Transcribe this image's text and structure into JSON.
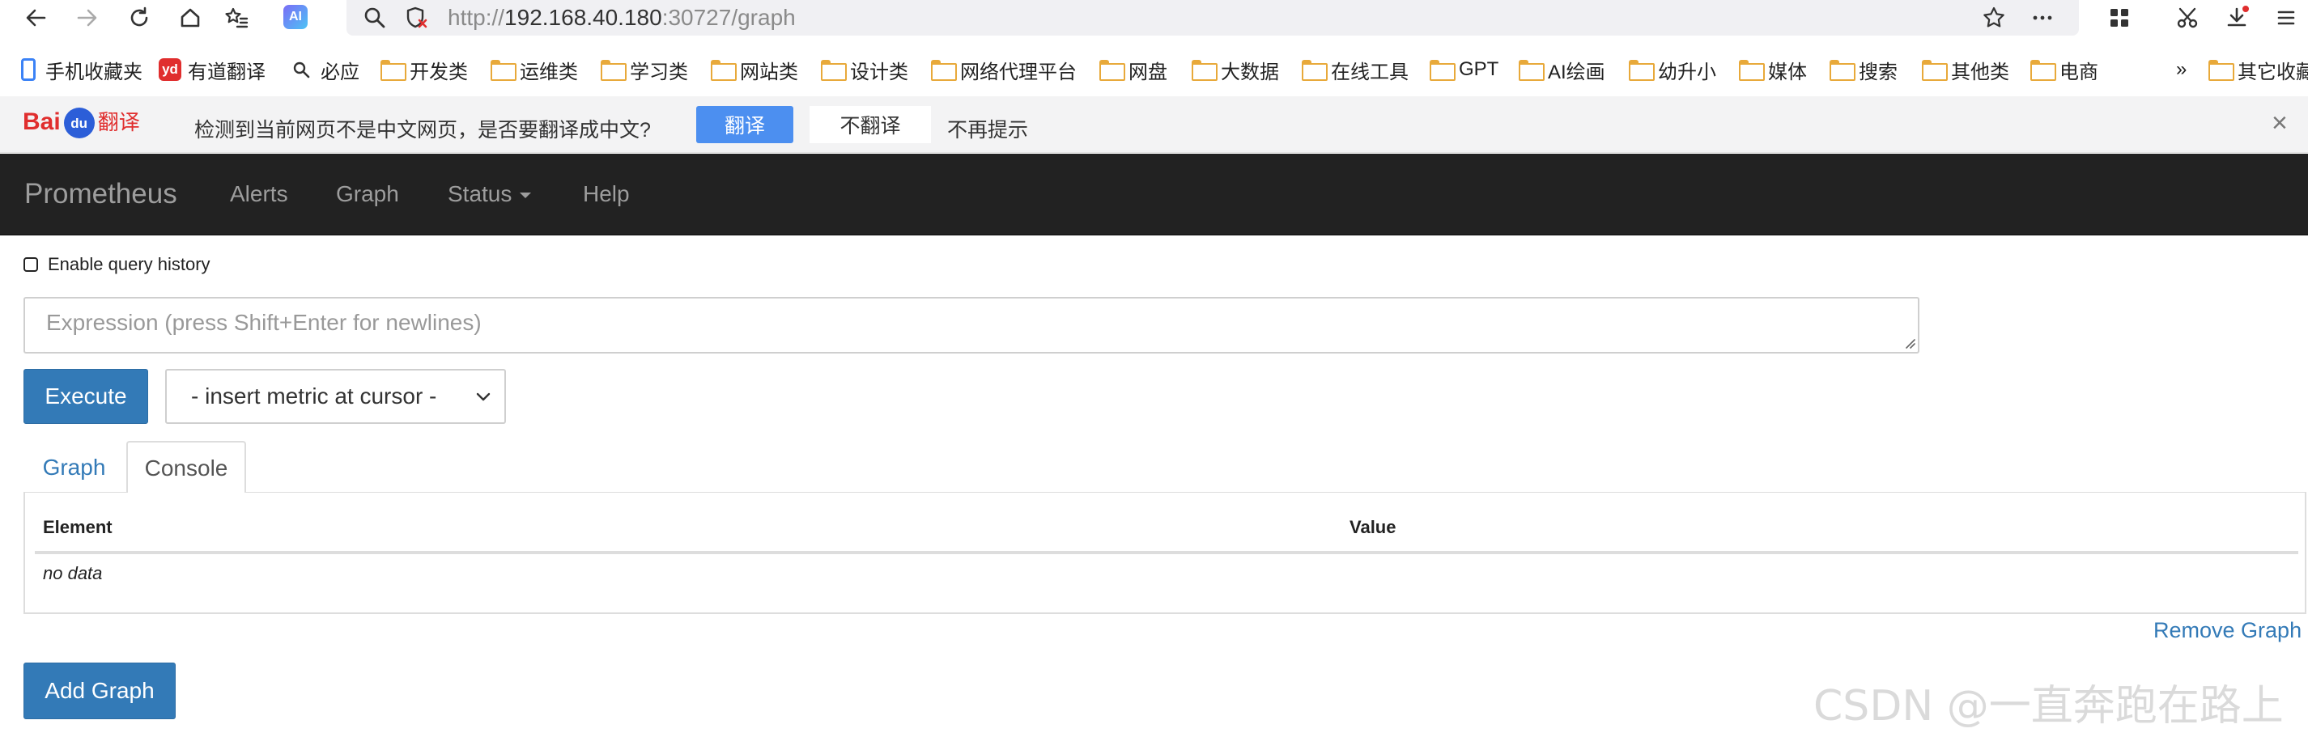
{
  "browser": {
    "ai_badge": "AI",
    "url_prefix": "http://",
    "url_host": "192.168.40.180",
    "url_rest": ":30727/graph",
    "bookmarks": [
      {
        "label": "手机收藏夹",
        "icon": "phone-icon"
      },
      {
        "label": "有道翻译",
        "icon": "youdao-icon",
        "badge": "yd"
      },
      {
        "label": "必应",
        "icon": "search-icon"
      },
      {
        "label": "开发类",
        "icon": "folder-icon"
      },
      {
        "label": "运维类",
        "icon": "folder-icon"
      },
      {
        "label": "学习类",
        "icon": "folder-icon"
      },
      {
        "label": "网站类",
        "icon": "folder-icon"
      },
      {
        "label": "设计类",
        "icon": "folder-icon"
      },
      {
        "label": "网络代理平台",
        "icon": "folder-icon"
      },
      {
        "label": "网盘",
        "icon": "folder-icon"
      },
      {
        "label": "大数据",
        "icon": "folder-icon"
      },
      {
        "label": "在线工具",
        "icon": "folder-icon"
      },
      {
        "label": "GPT",
        "icon": "folder-icon"
      },
      {
        "label": "AI绘画",
        "icon": "folder-icon"
      },
      {
        "label": "幼升小",
        "icon": "folder-icon"
      },
      {
        "label": "媒体",
        "icon": "folder-icon"
      },
      {
        "label": "搜索",
        "icon": "folder-icon"
      },
      {
        "label": "其他类",
        "icon": "folder-icon"
      },
      {
        "label": "电商",
        "icon": "folder-icon"
      }
    ],
    "overflow": "»",
    "other_bookmarks": "其它收藏"
  },
  "translate_bar": {
    "logo_bai": "Bai",
    "logo_du": "du",
    "logo_fanyi": "翻译",
    "message": "检测到当前网页不是中文网页，是否要翻译成中文?",
    "translate_button": "翻译",
    "no_translate_button": "不翻译",
    "never_prompt": "不再提示",
    "close": "×"
  },
  "navbar": {
    "brand": "Prometheus",
    "links": [
      "Alerts",
      "Graph",
      "Status",
      "Help"
    ]
  },
  "query": {
    "history_label": "Enable query history",
    "history_checked": false,
    "expression_value": "",
    "expression_placeholder": "Expression (press Shift+Enter for newlines)",
    "execute_label": "Execute",
    "metric_select": "- insert metric at cursor -"
  },
  "tabs": [
    "Graph",
    "Console"
  ],
  "active_tab": "Console",
  "table": {
    "headers": [
      "Element",
      "Value"
    ],
    "empty_text": "no data"
  },
  "remove_graph_label": "Remove Graph",
  "add_graph_label": "Add Graph",
  "watermark": "CSDN @一直奔跑在路上",
  "colors": {
    "navbar_bg": "#222222",
    "primary": "#337ab7",
    "translate_button": "#4c8ff0",
    "folder": "#e8a93a"
  }
}
